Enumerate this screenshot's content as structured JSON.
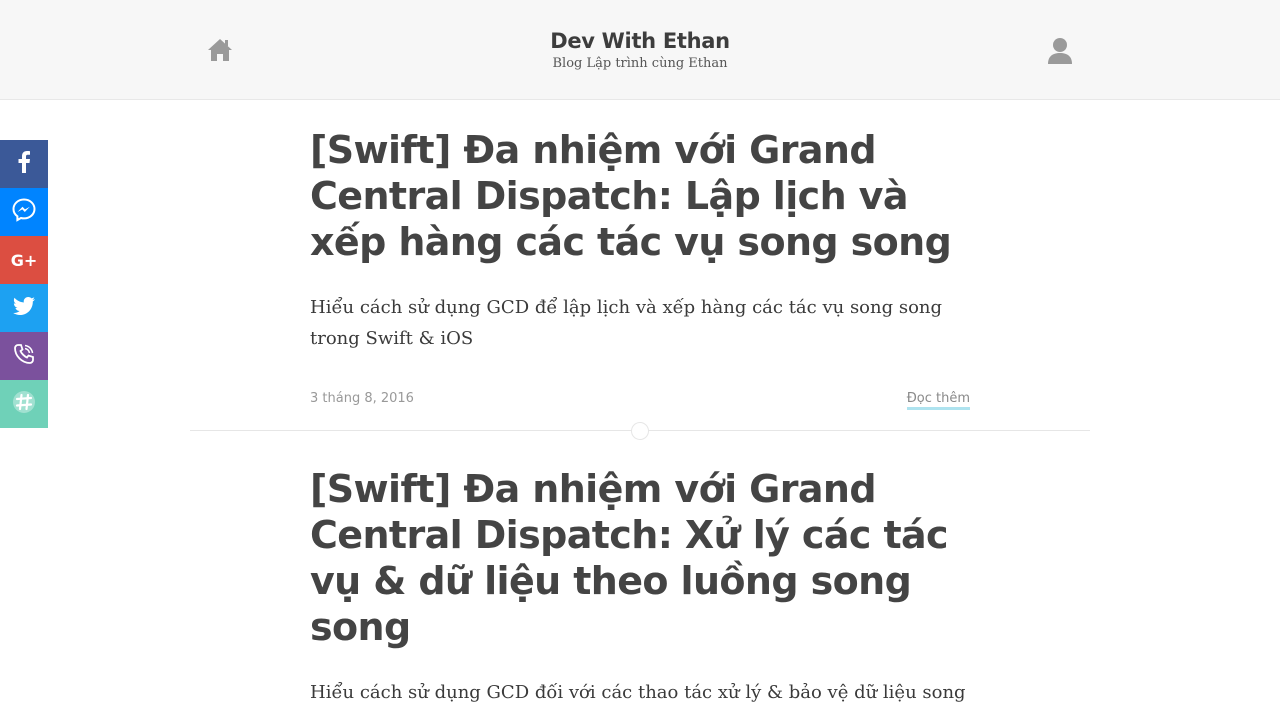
{
  "header": {
    "title": "Dev With Ethan",
    "subtitle": "Blog Lập trình cùng Ethan",
    "home_icon": "home-icon",
    "user_icon": "user-icon"
  },
  "share_bar": {
    "buttons": [
      {
        "name": "facebook",
        "icon": "facebook-icon",
        "color": "#3b5998"
      },
      {
        "name": "messenger",
        "icon": "messenger-icon",
        "color": "#0084ff"
      },
      {
        "name": "google-plus",
        "icon": "google-plus-icon",
        "color": "#dc4e41"
      },
      {
        "name": "twitter",
        "icon": "twitter-icon",
        "color": "#1da1f2"
      },
      {
        "name": "viber",
        "icon": "viber-icon",
        "color": "#7b519d"
      },
      {
        "name": "slack",
        "icon": "slack-icon",
        "color": "#6fd1b8"
      }
    ],
    "google_plus_label": "G+"
  },
  "posts": [
    {
      "title": "[Swift] Đa nhiệm với Grand Central Dispatch: Lập lịch và xếp hàng các tác vụ song song",
      "excerpt": "Hiểu cách sử dụng GCD để lập lịch và xếp hàng các tác vụ song song trong Swift & iOS",
      "date": "3 tháng 8, 2016",
      "read_more": "Đọc thêm"
    },
    {
      "title": "[Swift] Đa nhiệm với Grand Central Dispatch: Xử lý các tác vụ & dữ liệu theo luồng song song",
      "excerpt": "Hiểu cách sử dụng GCD đối với các thao tác xử lý & bảo vệ dữ liệu song"
    }
  ],
  "colors": {
    "header_bg": "#f7f7f7",
    "text": "#444444",
    "read_more_underline": "#aee3ef"
  }
}
